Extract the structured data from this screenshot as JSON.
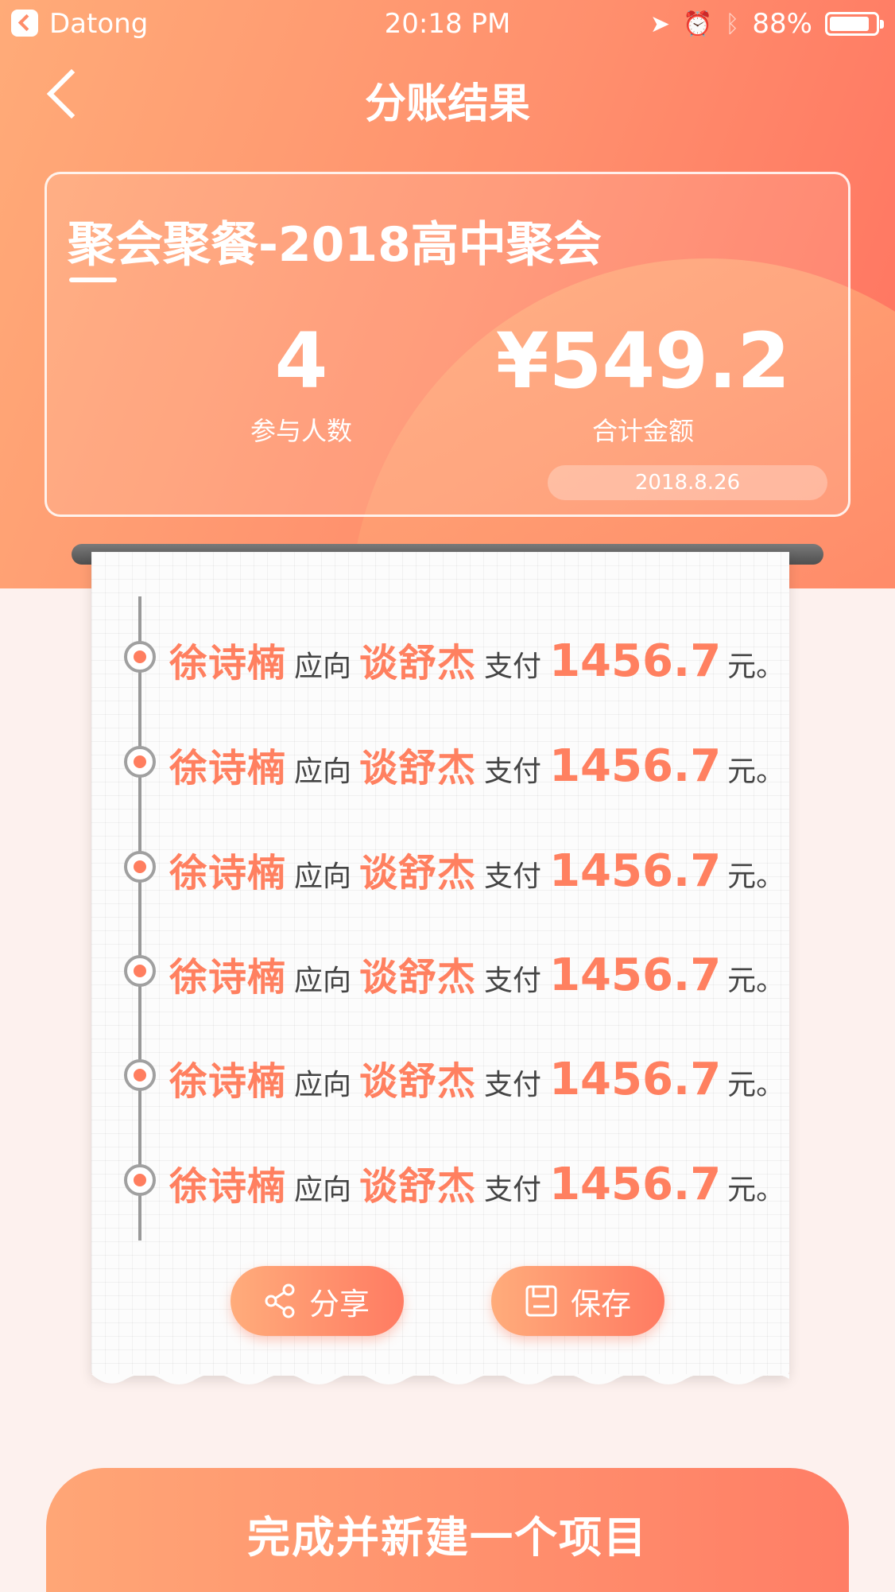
{
  "status_bar": {
    "carrier": "Datong",
    "time": "20:18 PM",
    "battery": "88%",
    "battery_level": 0.88,
    "icons": [
      "location-arrow-icon",
      "alarm-icon",
      "bluetooth-icon",
      "battery-icon"
    ]
  },
  "nav": {
    "title": "分账结果",
    "back_icon": "chevron-left-icon"
  },
  "summary": {
    "event_title": "聚会聚餐-2018高中聚会",
    "people_count": "4",
    "people_label": "参与人数",
    "total_amount": "¥549.2",
    "total_label": "合计金额",
    "date": "2018.8.26"
  },
  "records": [
    {
      "payer": "徐诗楠",
      "conn": "应向",
      "payee": "谈舒杰",
      "verb": "支付",
      "amount": "1456.7",
      "unit": "元。"
    },
    {
      "payer": "徐诗楠",
      "conn": "应向",
      "payee": "谈舒杰",
      "verb": "支付",
      "amount": "1456.7",
      "unit": "元。"
    },
    {
      "payer": "徐诗楠",
      "conn": "应向",
      "payee": "谈舒杰",
      "verb": "支付",
      "amount": "1456.7",
      "unit": "元。"
    },
    {
      "payer": "徐诗楠",
      "conn": "应向",
      "payee": "谈舒杰",
      "verb": "支付",
      "amount": "1456.7",
      "unit": "元。"
    },
    {
      "payer": "徐诗楠",
      "conn": "应向",
      "payee": "谈舒杰",
      "verb": "支付",
      "amount": "1456.7",
      "unit": "元。"
    },
    {
      "payer": "徐诗楠",
      "conn": "应向",
      "payee": "谈舒杰",
      "verb": "支付",
      "amount": "1456.7",
      "unit": "元。"
    }
  ],
  "actions": {
    "share_label": "分享",
    "share_icon": "share-icon",
    "save_label": "保存",
    "save_icon": "save-icon"
  },
  "primary_button": {
    "label": "完成并新建一个项目"
  },
  "colors": {
    "accent": "#ff8060",
    "gradient_start": "#ffab78",
    "gradient_end": "#ff7260",
    "page_bg": "#fdf1ee"
  }
}
